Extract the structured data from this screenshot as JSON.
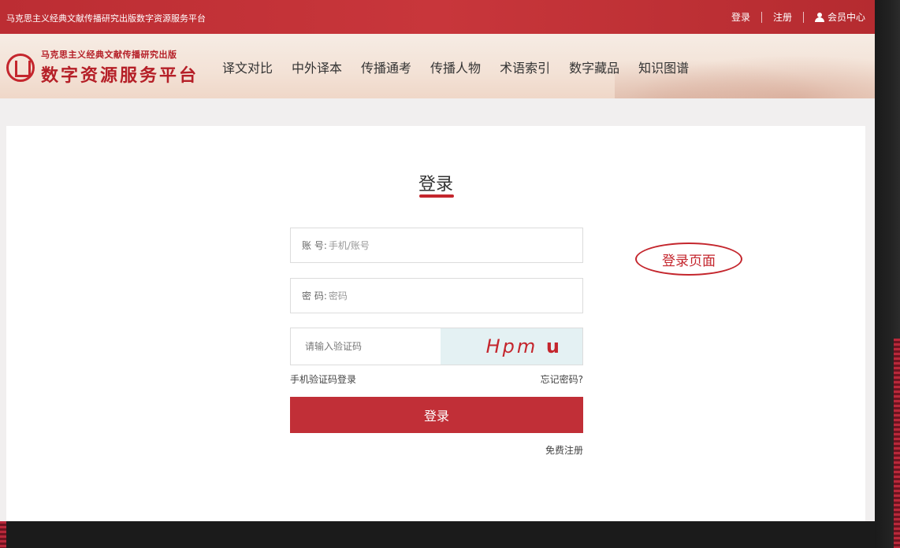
{
  "topbar": {
    "site_name": "马克思主义经典文献传播研究出版数字资源服务平台",
    "login": "登录",
    "register": "注册",
    "member_center": "会员中心",
    "user_icon": "user-icon"
  },
  "header": {
    "logo_line1": "马克思主义经典文献传播研究出版",
    "logo_line2": "数字资源服务平台",
    "nav": [
      "译文对比",
      "中外译本",
      "传播通考",
      "传播人物",
      "术语索引",
      "数字藏品",
      "知识图谱"
    ]
  },
  "login_form": {
    "title": "登录",
    "account_label": "账  号:",
    "account_placeholder": "手机/账号",
    "password_label": "密  码:",
    "password_placeholder": "密码",
    "captcha_placeholder": "请输入验证码",
    "captcha_text": "Hpm",
    "captcha_bold": "u",
    "sms_login": "手机验证码登录",
    "forgot_password": "忘记密码?",
    "submit": "登录",
    "free_register": "免费注册"
  },
  "annotation": "登录页面",
  "colors": {
    "brand_red": "#c4262d",
    "button_red": "#c12f37",
    "captcha_bg": "#e4f1f3"
  }
}
